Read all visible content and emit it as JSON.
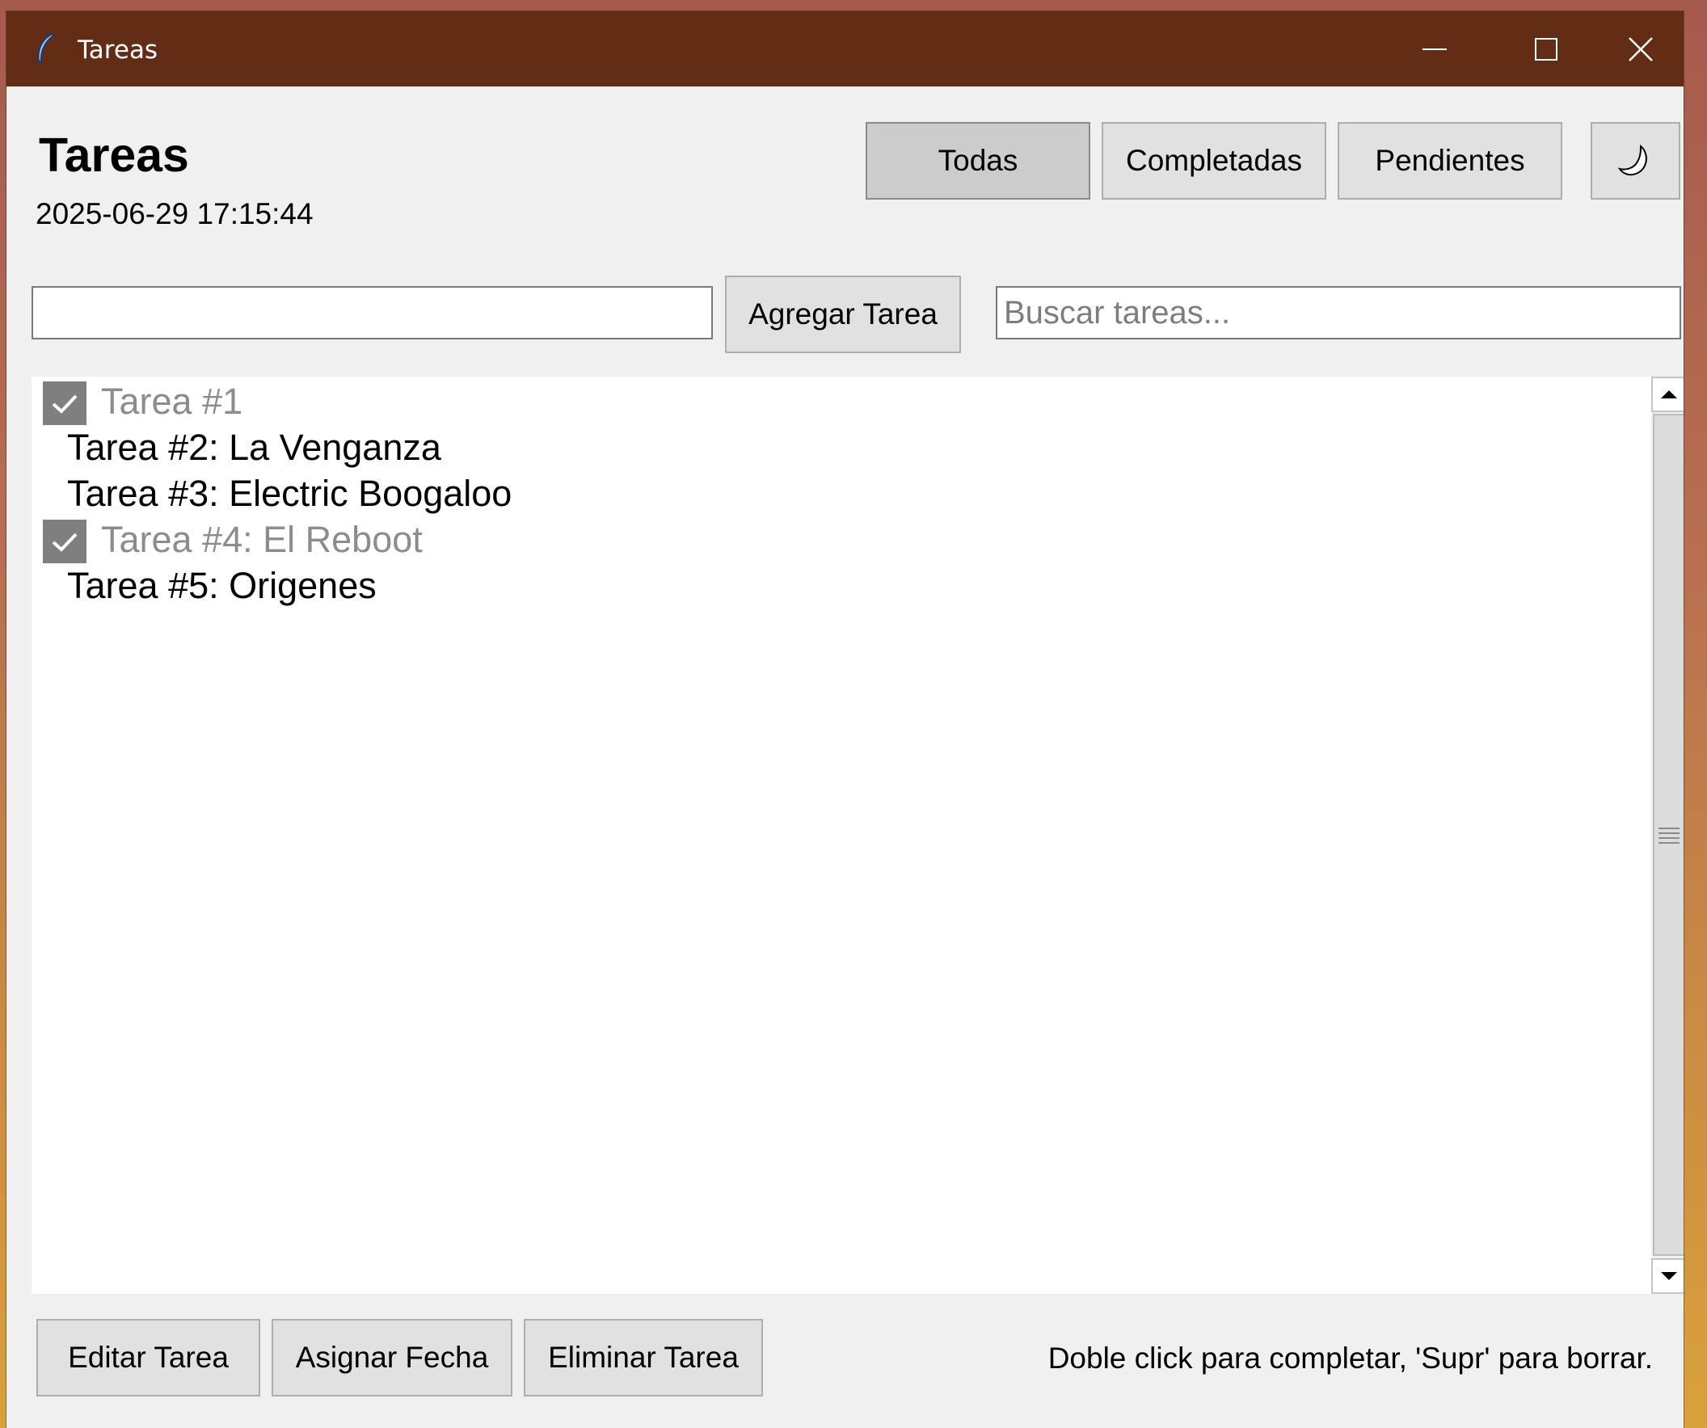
{
  "window": {
    "title": "Tareas"
  },
  "header": {
    "title": "Tareas",
    "datetime": "2025-06-29 17:15:44"
  },
  "filters": {
    "all_label": "Todas",
    "completed_label": "Completadas",
    "pending_label": "Pendientes",
    "active": "Todas",
    "theme_icon": "moon-icon"
  },
  "add": {
    "task_input_value": "",
    "button_label": "Agregar Tarea"
  },
  "search": {
    "placeholder": "Buscar tareas..."
  },
  "tasks": [
    {
      "label": "Tarea #1",
      "completed": true
    },
    {
      "label": "Tarea #2: La Venganza",
      "completed": false
    },
    {
      "label": "Tarea #3: Electric Boogaloo",
      "completed": false
    },
    {
      "label": "Tarea #4: El Reboot",
      "completed": true
    },
    {
      "label": "Tarea #5: Origenes",
      "completed": false
    }
  ],
  "actions": {
    "edit_label": "Editar Tarea",
    "date_label": "Asignar Fecha",
    "delete_label": "Eliminar Tarea"
  },
  "hint": "Doble click para completar, 'Supr' para borrar.",
  "colors": {
    "titlebar": "#632c15",
    "window_bg": "#f0f0f0",
    "completed_text": "#8c8c8c",
    "checkbox_fill": "#7f7f7f"
  }
}
